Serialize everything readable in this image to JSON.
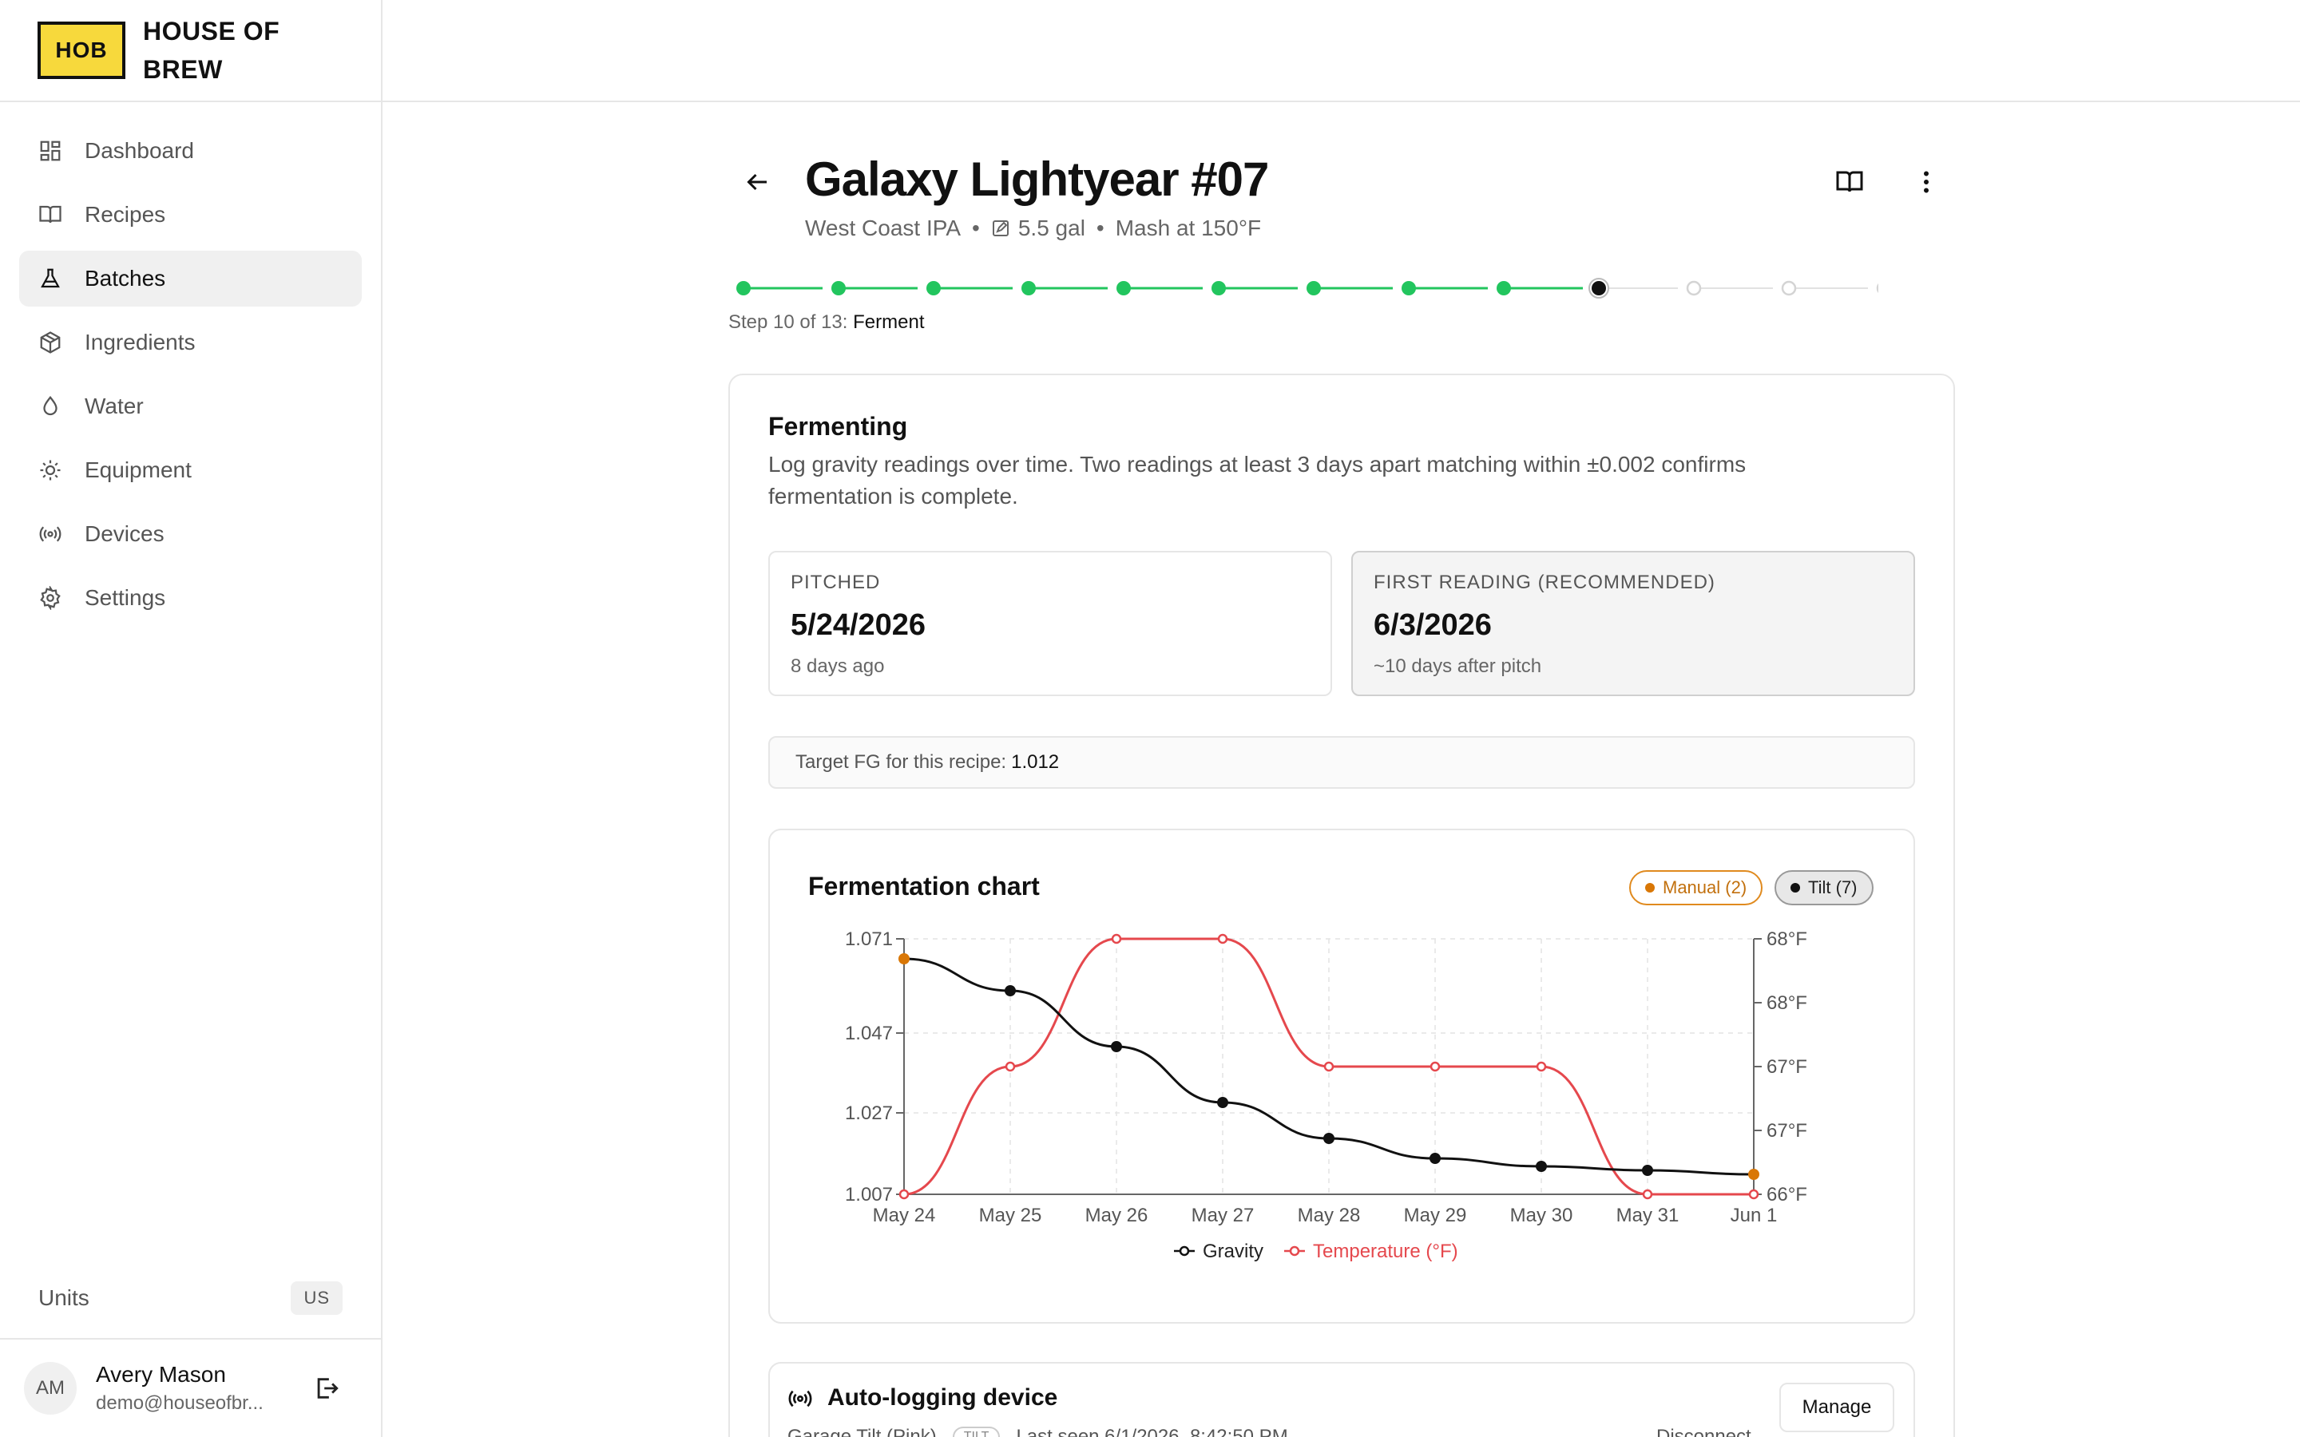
{
  "brand": {
    "logo_text": "HOB",
    "name_line1": "HOUSE OF",
    "name_line2": "BREW"
  },
  "sidebar": {
    "items": [
      {
        "label": "Dashboard",
        "icon": "dashboard-icon",
        "active": false
      },
      {
        "label": "Recipes",
        "icon": "book-icon",
        "active": false
      },
      {
        "label": "Batches",
        "icon": "flask-icon",
        "active": true
      },
      {
        "label": "Ingredients",
        "icon": "box-icon",
        "active": false
      },
      {
        "label": "Water",
        "icon": "droplet-icon",
        "active": false
      },
      {
        "label": "Equipment",
        "icon": "gear-icon",
        "active": false
      },
      {
        "label": "Devices",
        "icon": "radio-icon",
        "active": false
      },
      {
        "label": "Settings",
        "icon": "settings-icon",
        "active": false
      }
    ],
    "units_label": "Units",
    "units_value": "US",
    "user": {
      "initials": "AM",
      "name": "Avery Mason",
      "email": "demo@houseofbr..."
    }
  },
  "header": {
    "title": "Galaxy Lightyear #07",
    "style": "West Coast IPA",
    "volume": "5.5 gal",
    "mash": "Mash at 150°F"
  },
  "stepper": {
    "total": 13,
    "current": 10,
    "label_prefix": "Step 10 of 13:",
    "current_name": "Ferment",
    "colors": {
      "done": "#22c55e",
      "current": "#111111",
      "todo": "#d4d4d4"
    }
  },
  "fermenting": {
    "title": "Fermenting",
    "description": "Log gravity readings over time. Two readings at least 3 days apart matching within ±0.002 confirms fermentation is complete.",
    "pitched": {
      "label": "PITCHED",
      "value": "5/24/2026",
      "sub": "8 days ago"
    },
    "first_reading": {
      "label": "FIRST READING (RECOMMENDED)",
      "value": "6/3/2026",
      "sub": "~10 days after pitch"
    },
    "target_prefix": "Target FG for this recipe:",
    "target_value": "1.012"
  },
  "chart": {
    "title": "Fermentation chart",
    "badge_manual": "Manual (2)",
    "badge_tilt": "Tilt (7)",
    "legend_gravity": "Gravity",
    "legend_temp": "Temperature (°F)",
    "colors": {
      "gravity": "#111111",
      "temp": "#e5484d",
      "manual": "#d97706"
    }
  },
  "chart_data": {
    "type": "line",
    "title": "Fermentation chart",
    "categories": [
      "May 24",
      "May 25",
      "May 26",
      "May 27",
      "May 28",
      "May 29",
      "May 30",
      "May 31",
      "Jun 1"
    ],
    "y_left_ticks": [
      "1.071",
      "1.047",
      "1.027",
      "1.007"
    ],
    "y_left_range": [
      1.007,
      1.071
    ],
    "y_right_ticks": [
      "68°F",
      "68°F",
      "67°F",
      "67°F",
      "66°F"
    ],
    "y_right_range": [
      66,
      68
    ],
    "series": [
      {
        "name": "Gravity",
        "axis": "left",
        "values": [
          1.066,
          1.058,
          1.044,
          1.03,
          1.021,
          1.016,
          1.014,
          1.013,
          1.012
        ],
        "manual_points": [
          0,
          8
        ]
      },
      {
        "name": "Temperature (°F)",
        "axis": "right",
        "values": [
          66,
          67,
          68,
          68,
          67,
          67,
          67,
          66,
          66
        ]
      }
    ],
    "grid": true,
    "legend": "bottom"
  },
  "device": {
    "title": "Auto-logging device",
    "name": "Garage Tilt (Pink)",
    "tag": "TILT",
    "last_seen": "Last seen 6/1/2026, 8:42:50 PM",
    "disconnect": "Disconnect",
    "manage": "Manage"
  }
}
